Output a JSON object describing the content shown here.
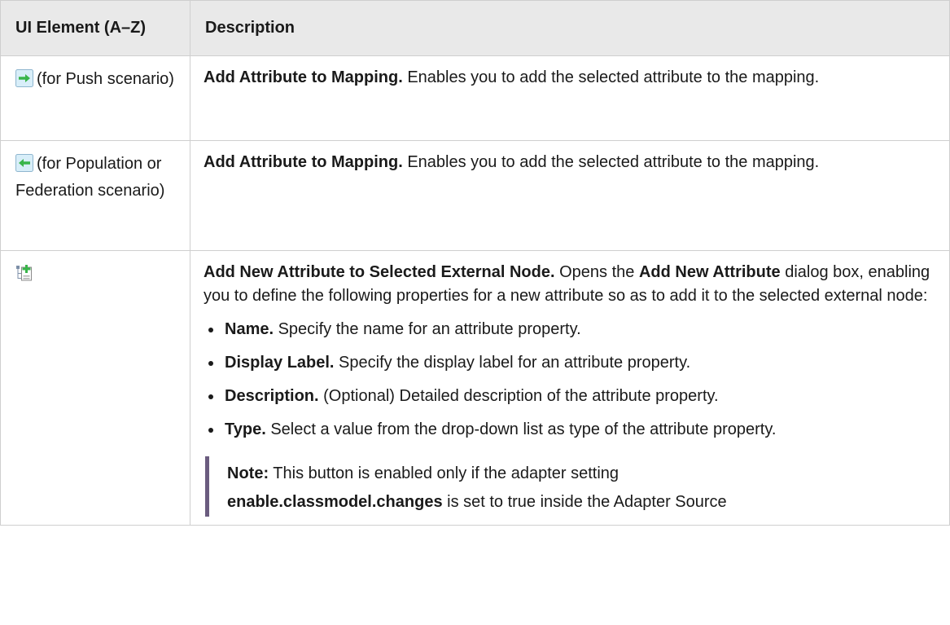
{
  "header": {
    "col1": "UI Element (A–Z)",
    "col2": "Description"
  },
  "rows": [
    {
      "icon": "arrow-right-icon",
      "element_label": "(for Push scenario)",
      "title": "Add Attribute to Mapping.",
      "text": " Enables you to add the selected attribute to the mapping."
    },
    {
      "icon": "arrow-left-icon",
      "element_label": "(for Population or Federation scenario)",
      "title": "Add Attribute to Mapping.",
      "text": " Enables you to add the selected attribute to the mapping."
    },
    {
      "icon": "add-attribute-node-icon",
      "title": "Add New Attribute to Selected External Node.",
      "text_a": " Opens the ",
      "bold_b": "Add New Attribute",
      "text_c": " dialog box, enabling you to define the following properties for a new attribute so as to add it to the selected external node:",
      "properties": [
        {
          "name": "Name.",
          "text": " Specify the name for an attribute property."
        },
        {
          "name": "Display Label.",
          "text": " Specify the display label for an attribute property."
        },
        {
          "name": "Description.",
          "text": " (Optional) Detailed description of the attribute property."
        },
        {
          "name": "Type.",
          "text": " Select a value from the drop-down list as type of the attribute property."
        }
      ],
      "note": {
        "label": "Note:",
        "text_a": " This button is enabled only if the adapter setting ",
        "setting": "enable.classmodel.changes",
        "text_b": " is set to true inside the Adapter Source"
      }
    }
  ],
  "colors": {
    "header_bg": "#e9e9e9",
    "border": "#cfcfcf",
    "arrow_green": "#3dbb3d",
    "note_bar": "#6b5c7f"
  }
}
